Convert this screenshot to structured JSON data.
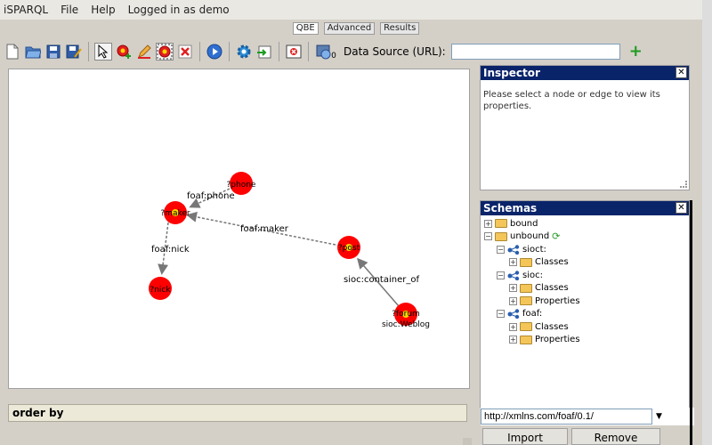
{
  "menu": {
    "app": "iSPARQL",
    "file": "File",
    "help": "Help",
    "login": "Logged in as demo"
  },
  "tabs": [
    {
      "label": "QBE",
      "active": true
    },
    {
      "label": "Advanced",
      "active": false
    },
    {
      "label": "Results",
      "active": false
    }
  ],
  "toolbar": {
    "badge_count": "0",
    "datasource_label": "Data Source (URL):",
    "datasource_value": ""
  },
  "graph": {
    "nodes": [
      {
        "label": "?phone"
      },
      {
        "label": "?maker"
      },
      {
        "label": "?nick"
      },
      {
        "label": "?post"
      },
      {
        "label": "?forum",
        "sub": "sioc:Weblog"
      }
    ],
    "edges": [
      {
        "label": "foaf:phone"
      },
      {
        "label": "foaf:nick"
      },
      {
        "label": "foaf:maker"
      },
      {
        "label": "sioc:container_of"
      }
    ]
  },
  "orderby": {
    "label": "order by"
  },
  "inspector": {
    "title": "Inspector",
    "message": "Please select a node or edge to view its properties."
  },
  "schemas": {
    "title": "Schemas",
    "tree": {
      "bound": "bound",
      "unbound": "unbound",
      "sioct": "sioct:",
      "sioct_classes": "Classes",
      "sioc": "sioc:",
      "sioc_classes": "Classes",
      "sioc_properties": "Properties",
      "foaf": "foaf:",
      "foaf_classes": "Classes",
      "foaf_properties": "Properties"
    },
    "uri_value": "http://xmlns.com/foaf/0.1/",
    "import_label": "Import",
    "remove_label": "Remove"
  },
  "colors": {
    "node_fill": "#ff0000",
    "node_core": "#ffd700",
    "panel_head": "#0a246a",
    "add_green": "#1e9b1e"
  }
}
